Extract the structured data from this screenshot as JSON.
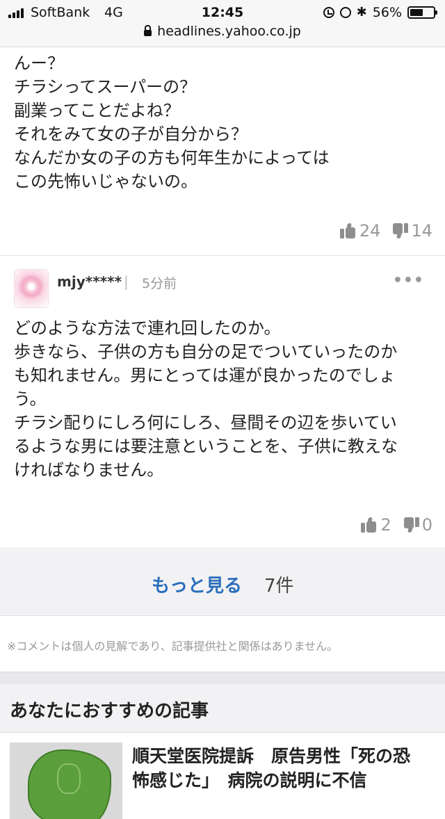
{
  "status_bar": {
    "carrier": "SoftBank",
    "network": "4G",
    "time": "12:45",
    "battery": "56%",
    "battery_level": 0.56,
    "url": "headlines.yahoo.co.jp"
  },
  "comments": [
    {
      "text": "んー？\nチラシってスーパーの？\n副業ってことだよね？\nそれをみて女の子が自分から？\nなんだか女の子の方も何年生かによっては\nこの先怖いじゃないの。",
      "likes": "24",
      "dislikes": "14"
    },
    {
      "user": "mjy*****",
      "separator": "|",
      "time": "5分前",
      "text": "どのような方法で連れ回したのか。\n歩きなら、子供の方も自分の足でついていったのか\nも知れません。男にとっては運が良かったのでしょ\nう。\nチラシ配りにしろ何にしろ、昼間その辺を歩いてい\nるような男には要注意ということを、子供に教えな\nければなりません。",
      "likes": "2",
      "dislikes": "0"
    }
  ],
  "more": {
    "label": "もっと見る",
    "count": "7件"
  },
  "disclaimer": "※コメントは個人の見解であり、記事提供社と関係はありません。",
  "recommend": {
    "title": "あなたにおすすめの記事",
    "article_title": "順天堂医院提訴　原告男性「死の恐怖感じた」　病院の説明に不信"
  },
  "colors": {
    "link": "#2a6ebb",
    "muted": "#999999",
    "band": "#f2f2f4"
  }
}
